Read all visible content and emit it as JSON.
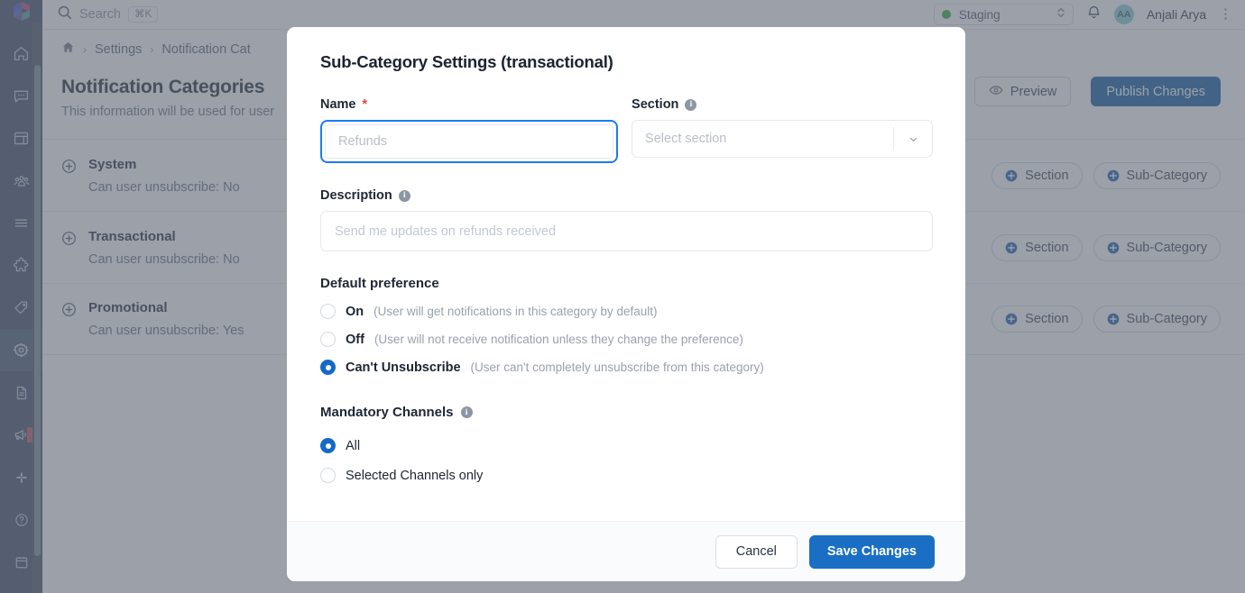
{
  "colors": {
    "rail_bg": "#4e5a70",
    "accent_blue": "#1a6fc4",
    "focus_blue": "#1a7cf0",
    "publish_blue": "#2266a8",
    "required_red": "#e8433f",
    "status_green": "#3cb44a",
    "badge_red": "#c8616b",
    "avatar_teal": "#8fd4d6"
  },
  "rail": {
    "logo_name": "suprsend-logo",
    "items": [
      {
        "icon": "home-icon",
        "name": "sidebar-item-home"
      },
      {
        "icon": "chat-icon",
        "name": "sidebar-item-messages"
      },
      {
        "icon": "layout-icon",
        "name": "sidebar-item-templates"
      },
      {
        "icon": "users-icon",
        "name": "sidebar-item-subscribers"
      },
      {
        "icon": "list-icon",
        "name": "sidebar-item-logs"
      },
      {
        "icon": "puzzle-icon",
        "name": "sidebar-item-integrations"
      },
      {
        "icon": "tag-icon",
        "name": "sidebar-item-tags"
      },
      {
        "icon": "gear-icon",
        "name": "sidebar-item-settings",
        "active": true
      }
    ],
    "bottom_items": [
      {
        "icon": "document-icon",
        "name": "sidebar-item-docs"
      },
      {
        "icon": "megaphone-icon",
        "name": "sidebar-item-whats-new",
        "badge": true
      },
      {
        "icon": "slack-icon",
        "name": "sidebar-item-slack"
      },
      {
        "icon": "help-circle-icon",
        "name": "sidebar-item-help"
      },
      {
        "icon": "calendar-icon",
        "name": "sidebar-item-calendar"
      }
    ]
  },
  "topbar": {
    "search_placeholder": "Search",
    "search_shortcut": "⌘K",
    "environment": "Staging",
    "notification_icon": "bell-icon",
    "avatar_initials": "AA",
    "user_name": "Anjali Arya",
    "kebab_icon": "more-vertical-icon"
  },
  "breadcrumb": {
    "home_icon": "home-icon",
    "items": [
      "Settings",
      "Notification Cat"
    ],
    "separator": "›"
  },
  "page": {
    "title": "Notification Categories",
    "subtitle": "This information will be used for user",
    "preview_label": "Preview",
    "preview_icon": "eye-icon",
    "publish_label": "Publish Changes",
    "categories": [
      {
        "name": "System",
        "meta": "Can user unsubscribe: No",
        "section_label": "Section",
        "subcategory_label": "Sub-Category"
      },
      {
        "name": "Transactional",
        "meta": "Can user unsubscribe: No",
        "section_label": "Section",
        "subcategory_label": "Sub-Category"
      },
      {
        "name": "Promotional",
        "meta": "Can user unsubscribe: Yes",
        "section_label": "Section",
        "subcategory_label": "Sub-Category"
      }
    ]
  },
  "modal": {
    "title": "Sub-Category Settings (transactional)",
    "name_field": {
      "label": "Name",
      "required_mark": "*",
      "value": "",
      "placeholder": "Refunds"
    },
    "section_field": {
      "label": "Section",
      "info_icon": "info-icon",
      "value": "",
      "placeholder": "Select section",
      "caret_icon": "chevron-down-icon"
    },
    "description_field": {
      "label": "Description",
      "info_icon": "info-icon",
      "value": "",
      "placeholder": "Send me updates on refunds received"
    },
    "default_preference": {
      "title": "Default preference",
      "options": [
        {
          "label": "On",
          "hint": "(User will get notifications in this category by default)",
          "selected": false
        },
        {
          "label": "Off",
          "hint": "(User will not receive notification unless they change the preference)",
          "selected": false
        },
        {
          "label": "Can't Unsubscribe",
          "hint": "(User can't completely unsubscribe from this category)",
          "selected": true
        }
      ]
    },
    "mandatory_channels": {
      "title": "Mandatory Channels",
      "info_icon": "info-icon",
      "options": [
        {
          "label": "All",
          "selected": true
        },
        {
          "label": "Selected Channels only",
          "selected": false
        }
      ]
    },
    "cancel_label": "Cancel",
    "save_label": "Save Changes"
  }
}
